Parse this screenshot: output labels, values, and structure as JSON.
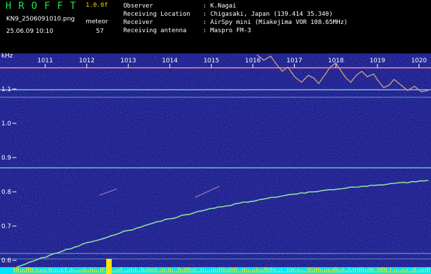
{
  "header": {
    "app_title": "H R O F F T",
    "version": "1.0.0f",
    "filename": "KN9_2506091010.png",
    "timestamp": "25.06.09 10:10",
    "meteor_label": "meteor",
    "meteor_count": "57",
    "info": [
      {
        "label": "Observer",
        "value": ": K.Nagai"
      },
      {
        "label": "Receiving Location",
        "value": ": Chigasaki, Japan (139.414 35.340)"
      },
      {
        "label": "Receiver",
        "value": ": AirSpy mini (Miakejima VOR 108.65MHz)"
      },
      {
        "label": "Receiving antenna",
        "value": ": Maspro FM-3"
      }
    ]
  },
  "axes": {
    "y_unit": "kHz",
    "y_ticks": [
      "1.1",
      "1.0",
      "0.9",
      "0.8",
      "0.7",
      "0.6"
    ],
    "x_ticks": [
      "1011",
      "1012",
      "1013",
      "1014",
      "1015",
      "1016",
      "1017",
      "1018",
      "1019",
      "1020"
    ]
  },
  "colors": {
    "background": "#1c1c86",
    "trace": "#8fe0a0",
    "hline": "#7fd6d6",
    "hline_top": "#d47a9a",
    "bottom_bar": "#00e5ff",
    "bottom_spike": "#ffe600",
    "grid_tick": "#ffffff"
  }
}
